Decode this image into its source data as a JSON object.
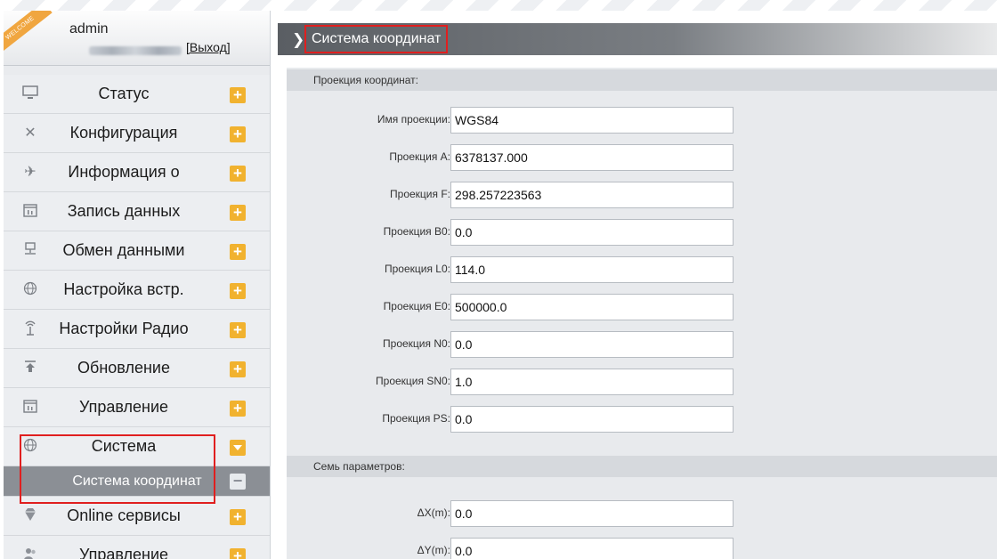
{
  "user": {
    "welcome_badge": "WELCOME",
    "name": "admin",
    "logout_label": "[Выход]"
  },
  "sidebar": {
    "items": [
      {
        "label": "Статус",
        "icon": "monitor-icon"
      },
      {
        "label": "Конфигурация",
        "icon": "tools-icon"
      },
      {
        "label": "Информация о",
        "icon": "satellite-icon"
      },
      {
        "label": "Запись данных",
        "icon": "calendar-icon"
      },
      {
        "label": "Обмен данными",
        "icon": "network-icon"
      },
      {
        "label": "Настройка встр.",
        "icon": "globe-icon"
      },
      {
        "label": "Настройки Радио",
        "icon": "radio-tower-icon"
      },
      {
        "label": "Обновление",
        "icon": "upload-icon"
      },
      {
        "label": "Управление",
        "icon": "calendar-icon"
      },
      {
        "label": "Система",
        "icon": "globe-icon",
        "expanded": true
      },
      {
        "label": "Система координат",
        "sub": true,
        "selected": true
      },
      {
        "label": "Online сервисы",
        "icon": "diamond-icon"
      },
      {
        "label": "Управление",
        "icon": "users-icon"
      }
    ]
  },
  "main": {
    "title": "Система координат",
    "sections": {
      "projection": "Проекция координат:",
      "seven_params": "Семь параметров:"
    },
    "projection_fields": [
      {
        "label": "Имя проекции:",
        "value": "WGS84"
      },
      {
        "label": "Проекция A:",
        "value": "6378137.000"
      },
      {
        "label": "Проекция F:",
        "value": "298.257223563"
      },
      {
        "label": "Проекция B0:",
        "value": "0.0"
      },
      {
        "label": "Проекция L0:",
        "value": "114.0"
      },
      {
        "label": "Проекция E0:",
        "value": "500000.0"
      },
      {
        "label": "Проекция N0:",
        "value": "0.0"
      },
      {
        "label": "Проекция SN0:",
        "value": "1.0"
      },
      {
        "label": "Проекция PS:",
        "value": "0.0"
      }
    ],
    "seven_param_fields": [
      {
        "label": "ΔX(m):",
        "value": "0.0"
      },
      {
        "label": "ΔY(m):",
        "value": "0.0"
      }
    ]
  },
  "colors": {
    "accent_orange": "#f1b22f",
    "highlight_red": "#e01f1f",
    "title_bar_dark": "#5a5e63",
    "selected_item": "#8b8f95"
  }
}
